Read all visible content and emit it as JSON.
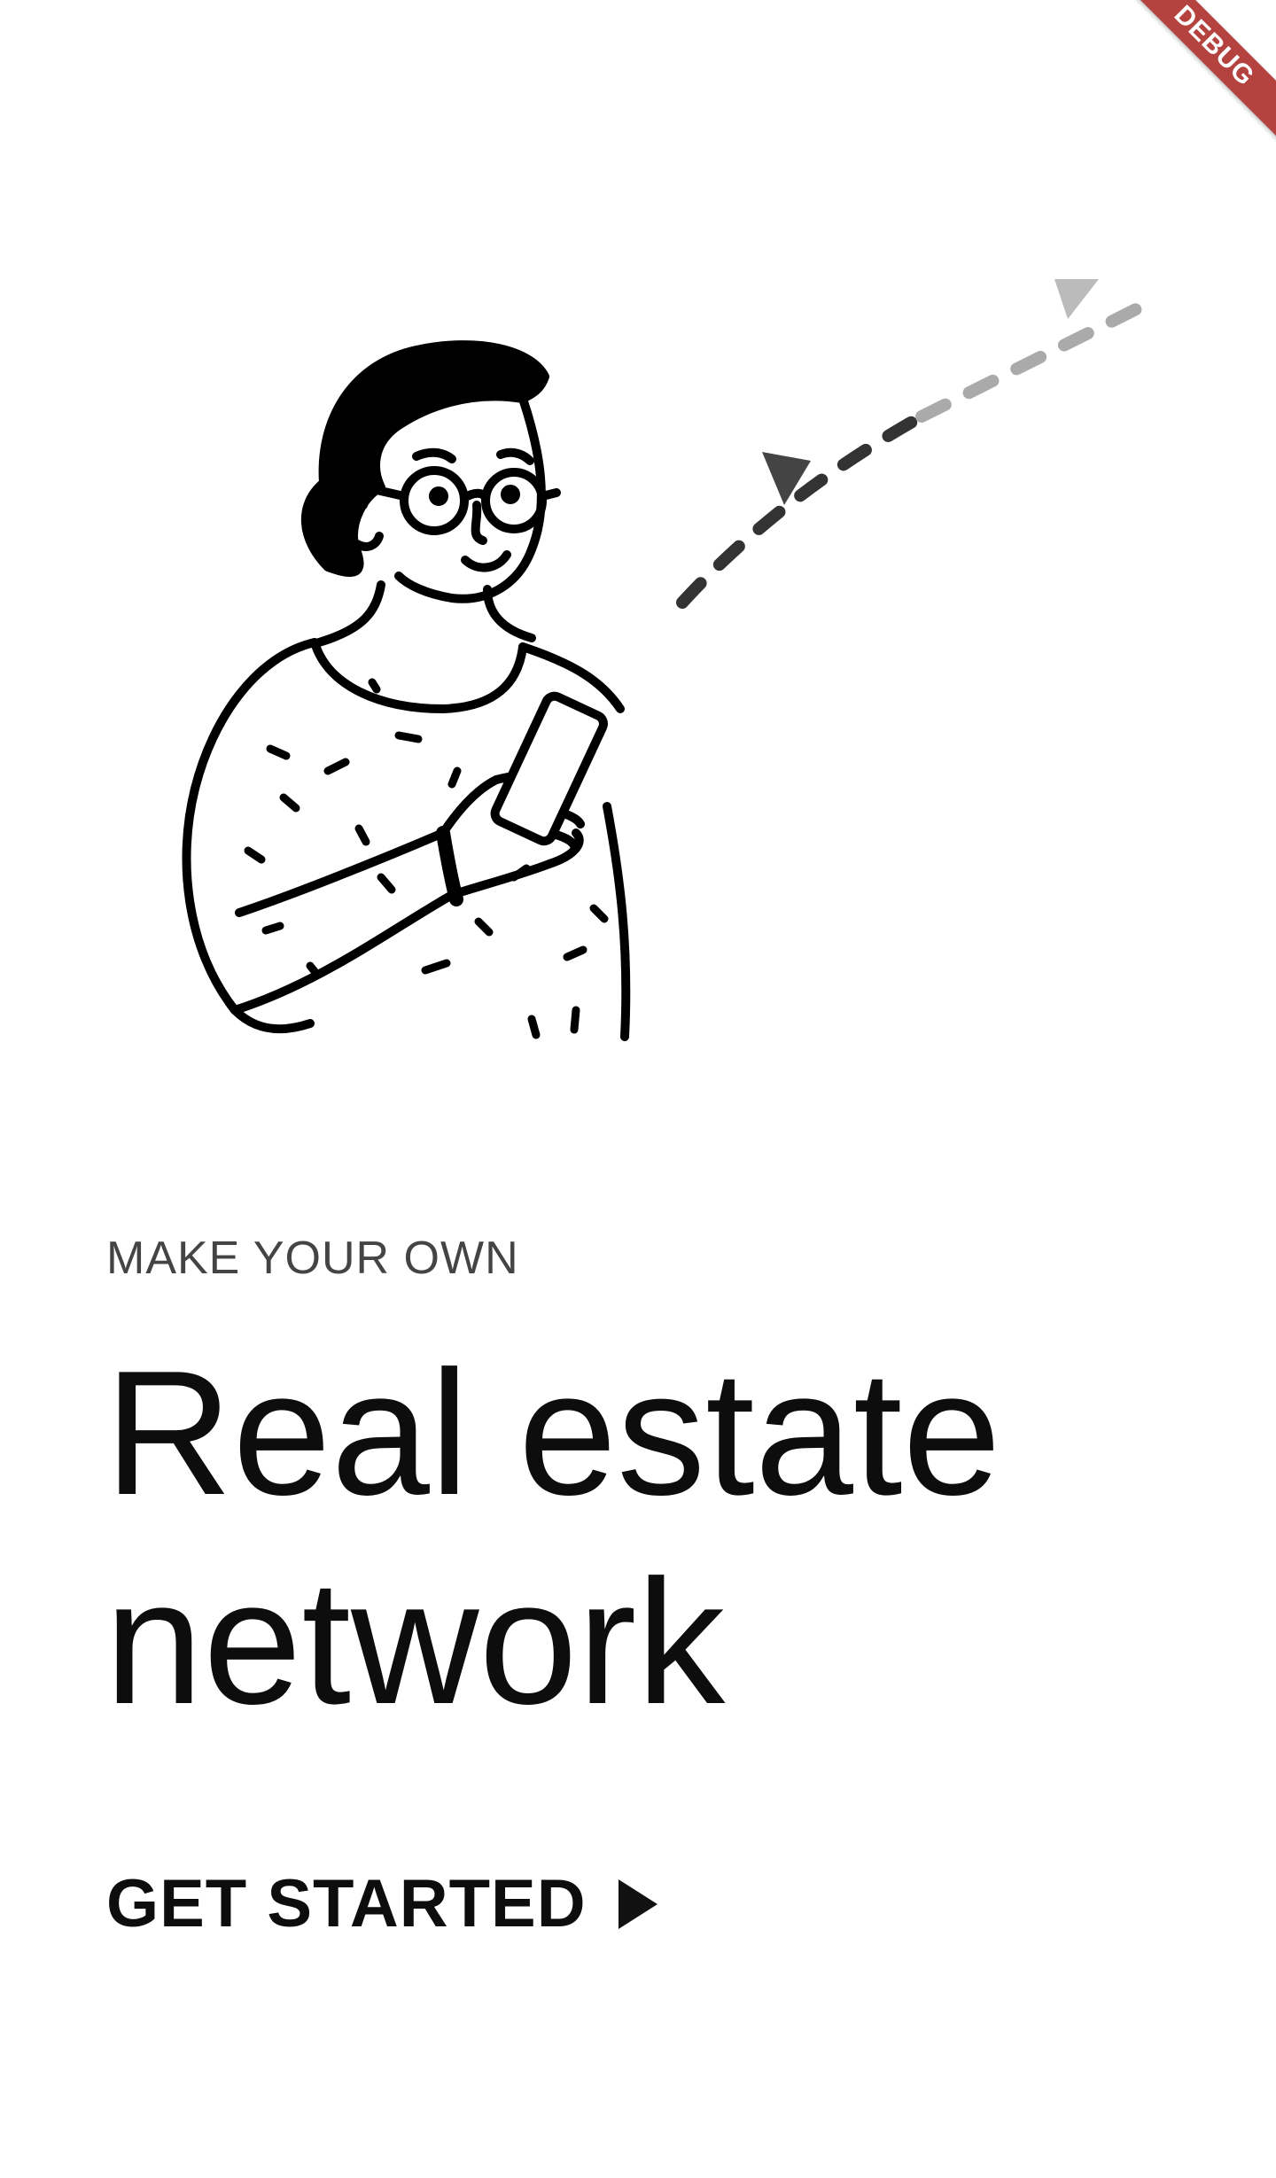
{
  "debug_banner": {
    "label": "DEBUG"
  },
  "illustration": {
    "icon": "person-with-phone-illustration"
  },
  "onboarding": {
    "eyebrow": "MAKE YOUR OWN",
    "headline_line1": "Real estate",
    "headline_line2": "network",
    "cta_label": "GET STARTED",
    "cta_icon": "play-arrow-icon"
  },
  "colors": {
    "background": "#ffffff",
    "text_primary": "#0d0d0d",
    "text_secondary": "#444444",
    "debug_banner": "#b4433f"
  }
}
